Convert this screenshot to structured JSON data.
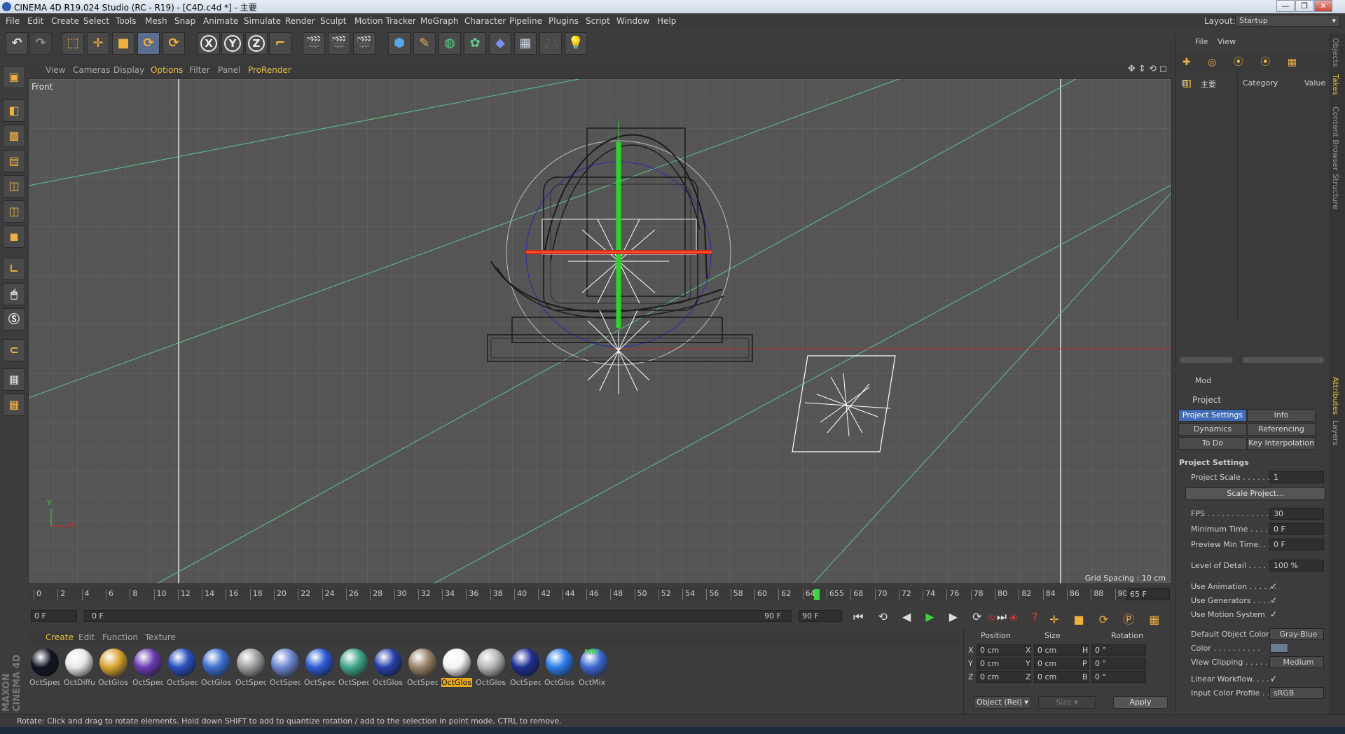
{
  "window": {
    "title": "CINEMA 4D R19.024 Studio (RC - R19) - [C4D.c4d *] - 主要",
    "controls": [
      "—",
      "❐",
      "✕"
    ]
  },
  "menu": [
    "File",
    "Edit",
    "Create",
    "Select",
    "Tools",
    "Mesh",
    "Snap",
    "Animate",
    "Simulate",
    "Render",
    "Sculpt",
    "Motion Tracker",
    "MoGraph",
    "Character",
    "Pipeline",
    "Plugins",
    "Script",
    "Window",
    "Help"
  ],
  "layout": {
    "label": "Layout:",
    "value": "Startup"
  },
  "main_toolbar": {
    "axis_x": "X",
    "axis_y": "Y",
    "axis_z": "Z"
  },
  "viewport": {
    "menu": [
      "View",
      "Cameras",
      "Display",
      "Options",
      "Filter",
      "Panel",
      "ProRender"
    ],
    "name": "Front",
    "grid_spacing": "Grid Spacing : 10 cm",
    "axis_y": "Y",
    "axis_x": "X"
  },
  "timeline": {
    "ticks": [
      "0",
      "2",
      "4",
      "6",
      "8",
      "10",
      "12",
      "14",
      "16",
      "18",
      "20",
      "22",
      "24",
      "26",
      "28",
      "30",
      "32",
      "34",
      "36",
      "38",
      "40",
      "42",
      "44",
      "46",
      "48",
      "50",
      "52",
      "54",
      "56",
      "58",
      "60",
      "62",
      "64",
      "655",
      "68",
      "70",
      "72",
      "74",
      "76",
      "78",
      "80",
      "82",
      "84",
      "86",
      "88",
      "90"
    ],
    "current_frame": "65 F",
    "start": "0 F",
    "range_start": "0 F",
    "range_end": "90 F",
    "end": "90 F"
  },
  "materials": {
    "menu": [
      "Create",
      "Edit",
      "Function",
      "Texture"
    ],
    "items": [
      {
        "label": "OctSpec",
        "color": "#111522"
      },
      {
        "label": "OctDiffu",
        "color": "#e8e8e8"
      },
      {
        "label": "OctGlos",
        "color": "#d9a431"
      },
      {
        "label": "OctSpec",
        "color": "#6a3bb0"
      },
      {
        "label": "OctSpec",
        "color": "#2a4fc0"
      },
      {
        "label": "OctGlos",
        "color": "#3c6fd1"
      },
      {
        "label": "OctSpec",
        "color": "#a0a0a0"
      },
      {
        "label": "OctSpec",
        "color": "#6d86d0"
      },
      {
        "label": "OctSpec",
        "color": "#2c5bd4"
      },
      {
        "label": "OctSpec",
        "color": "#3fa58c"
      },
      {
        "label": "OctGlos",
        "color": "#263fa8"
      },
      {
        "label": "OctSpec",
        "color": "#9c8468"
      },
      {
        "label": "OctGlos",
        "color": "#f4f4f4"
      },
      {
        "label": "OctGlos",
        "color": "#b6b6b6"
      },
      {
        "label": "OctSpec",
        "color": "#1f2e95"
      },
      {
        "label": "OctGlos",
        "color": "#2a7ce8"
      },
      {
        "label": "OctMix",
        "color": "#3d69d3"
      }
    ],
    "mix_tag": "MIX"
  },
  "coords": {
    "headers": [
      "Position",
      "Size",
      "Rotation"
    ],
    "rows": [
      {
        "axis": "X",
        "pos": "0 cm",
        "saxis": "X",
        "size": "0 cm",
        "raxis": "H",
        "rot": "0 °"
      },
      {
        "axis": "Y",
        "pos": "0 cm",
        "saxis": "Y",
        "size": "0 cm",
        "raxis": "P",
        "rot": "0 °"
      },
      {
        "axis": "Z",
        "pos": "0 cm",
        "saxis": "Z",
        "size": "0 cm",
        "raxis": "B",
        "rot": "0 °"
      }
    ],
    "mode": "Object (Rel)",
    "size_mode": "Size",
    "apply": "Apply"
  },
  "objects_panel": {
    "menu": [
      "File",
      "View"
    ],
    "take": "主要",
    "col_category": "Category",
    "col_value": "Value"
  },
  "attributes": {
    "mode": "Mod",
    "title": "Project",
    "tabs": [
      "Project Settings",
      "Info",
      "Dynamics",
      "Referencing",
      "To Do",
      "Key Interpolation"
    ],
    "section": "Project Settings",
    "scale_button": "Scale Project...",
    "fields": [
      {
        "label": "Project Scale . . . . . . .",
        "value": "1"
      },
      {
        "label": "FPS . . . . . . . . . . . . . . .",
        "value": "30"
      },
      {
        "label": "Minimum Time . . . . .",
        "value": "0 F"
      },
      {
        "label": "Preview Min Time. . . .",
        "value": "0 F"
      },
      {
        "label": "Level of Detail . . . . . .",
        "value": "100 %"
      }
    ],
    "checks": [
      {
        "label": "Use Animation . . . . . .",
        "value": "✓"
      },
      {
        "label": "Use Generators . . . . .",
        "value": "✓"
      },
      {
        "label": "Use Motion System",
        "value": "✓"
      }
    ],
    "default_color_label": "Default Object Color",
    "default_color_value": "Gray-Blue",
    "color_label": "Color . . . . . . . . . .",
    "view_clipping_label": "View Clipping . . . . . .",
    "view_clipping_value": "Medium",
    "linear_workflow_label": "Linear Workflow. . . . .",
    "linear_workflow_value": "✓",
    "input_profile_label": "Input Color Profile . . .",
    "input_profile_value": "sRGB"
  },
  "side_tabs": [
    "Objects",
    "Takes",
    "Content Browser",
    "Structure",
    "Attributes",
    "Layers"
  ],
  "status": "Rotate: Click and drag to rotate elements. Hold down SHIFT to add to quantize rotation / add to the selection in point mode, CTRL to remove.",
  "brand": "MAXON CINEMA 4D"
}
